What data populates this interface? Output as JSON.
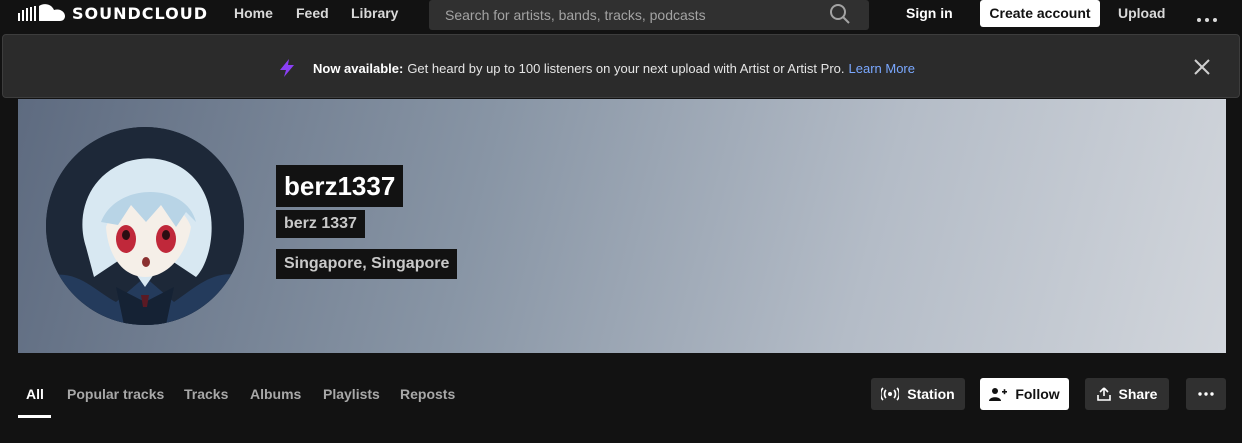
{
  "header": {
    "logo_text": "SOUNDCLOUD",
    "nav": [
      "Home",
      "Feed",
      "Library"
    ],
    "search_placeholder": "Search for artists, bands, tracks, podcasts",
    "sign_in": "Sign in",
    "create_account": "Create account",
    "upload": "Upload"
  },
  "banner": {
    "strong": "Now available:",
    "text": "Get heard by up to 100 listeners on your next upload with Artist or Artist Pro.",
    "link": "Learn More",
    "accent": "#8a3ff5"
  },
  "profile": {
    "username": "berz1337",
    "display_name": "berz 1337",
    "location": "Singapore, Singapore"
  },
  "tabs": [
    {
      "label": "All",
      "active": true
    },
    {
      "label": "Popular tracks",
      "active": false
    },
    {
      "label": "Tracks",
      "active": false
    },
    {
      "label": "Albums",
      "active": false
    },
    {
      "label": "Playlists",
      "active": false
    },
    {
      "label": "Reposts",
      "active": false
    }
  ],
  "actions": {
    "station": "Station",
    "follow": "Follow",
    "share": "Share"
  },
  "icons": [
    "soundcloud-logo-icon",
    "search-icon",
    "more-icon",
    "lightning-icon",
    "close-icon",
    "station-icon",
    "follow-icon",
    "share-icon"
  ]
}
